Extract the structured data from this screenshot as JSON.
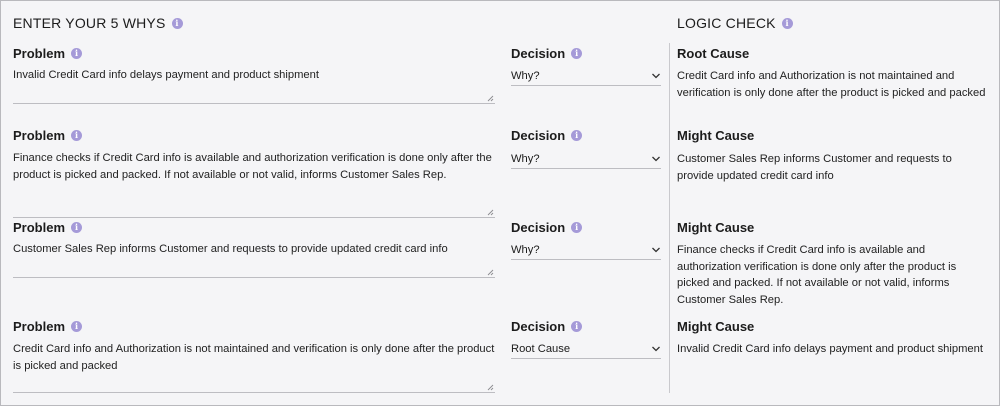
{
  "header": {
    "title": "ENTER YOUR 5 WHYS",
    "logic_title": "LOGIC CHECK"
  },
  "labels": {
    "problem": "Problem",
    "decision": "Decision"
  },
  "rows": [
    {
      "problem": "Invalid Credit Card info delays payment and product shipment",
      "decision": "Why?",
      "logic_head": "Root Cause",
      "logic_text": "Credit Card info and Authorization is not maintained and verification is only done after the product is picked and packed"
    },
    {
      "problem": "Finance checks if Credit Card info is available and authorization verification is done only after the product is picked and packed.  If not available or not valid, informs Customer Sales Rep.",
      "decision": "Why?",
      "logic_head": "Might Cause",
      "logic_text": "Customer Sales Rep informs Customer and requests to provide updated credit card info"
    },
    {
      "problem": "Customer Sales Rep informs Customer and requests to provide updated credit card info",
      "decision": "Why?",
      "logic_head": "Might Cause",
      "logic_text": "Finance checks if Credit Card info is available and authorization verification is done only after the product is picked and packed. If not available or not valid, informs Customer Sales Rep."
    },
    {
      "problem": "Credit Card info and Authorization is not maintained and verification is only done after the product is picked and packed",
      "decision": "Root Cause",
      "logic_head": "Might Cause",
      "logic_text": "Invalid Credit Card info delays payment and product shipment"
    }
  ],
  "icons": {
    "info": "info-icon",
    "dropdown": "chevron-down-icon",
    "resize": "resize-handle-icon"
  },
  "colors": {
    "accent": "#a59ad8",
    "background": "#f5f5f7",
    "border": "#bdbdc2"
  }
}
